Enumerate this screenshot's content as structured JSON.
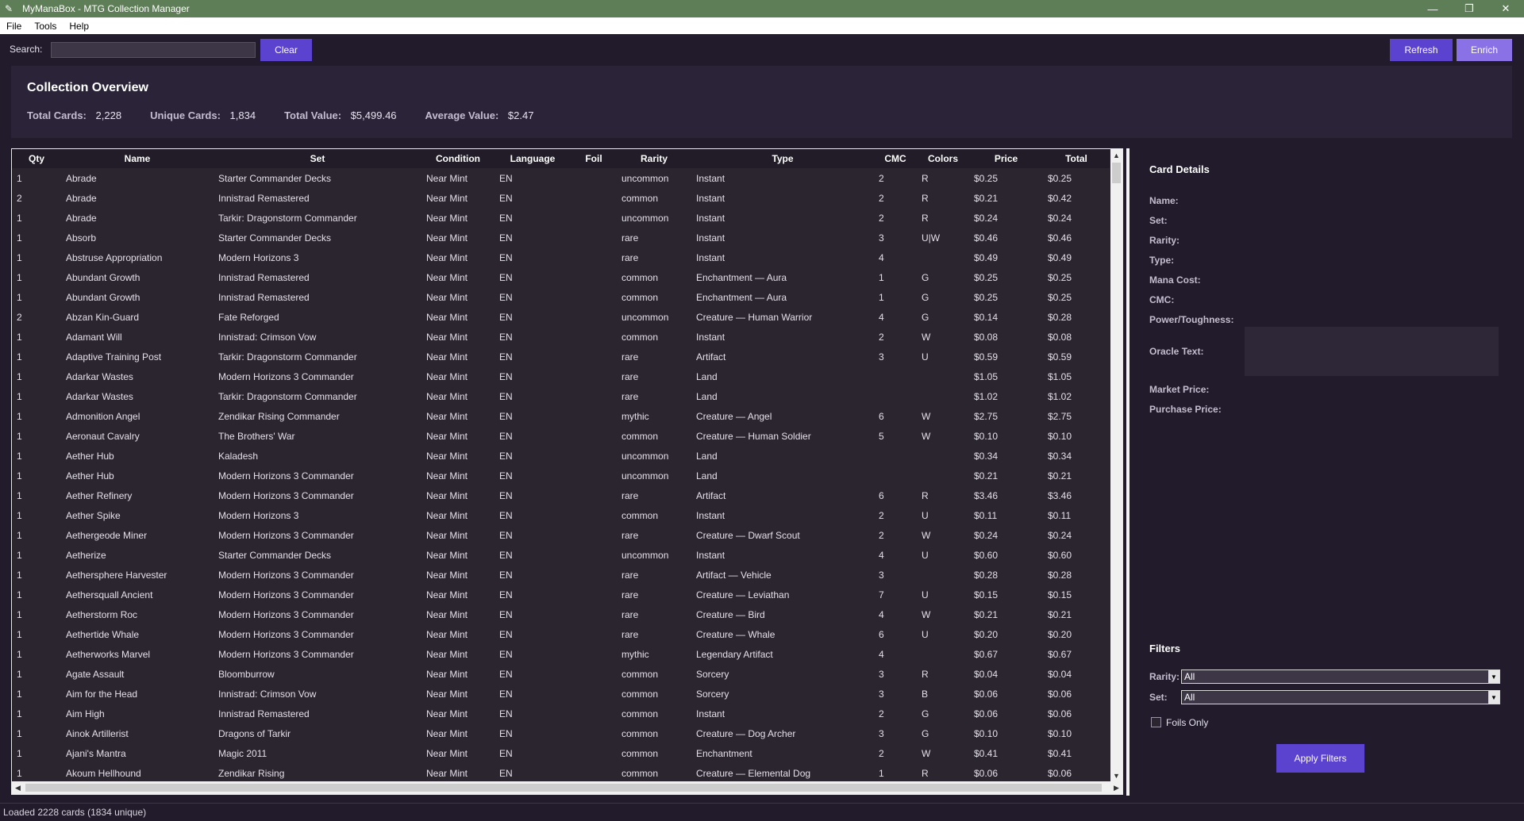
{
  "window": {
    "title": "MyManaBox - MTG Collection Manager",
    "controls": {
      "minimize": "—",
      "maximize": "❐",
      "close": "✕"
    }
  },
  "menu": [
    "File",
    "Tools",
    "Help"
  ],
  "toolbar": {
    "search_label": "Search:",
    "search_value": "",
    "clear_label": "Clear",
    "refresh_label": "Refresh",
    "enrich_label": "Enrich"
  },
  "overview": {
    "title": "Collection Overview",
    "stats": [
      {
        "label": "Total Cards:",
        "value": "2,228"
      },
      {
        "label": "Unique Cards:",
        "value": "1,834"
      },
      {
        "label": "Total Value:",
        "value": "$5,499.46"
      },
      {
        "label": "Average Value:",
        "value": "$2.47"
      }
    ]
  },
  "table": {
    "columns": [
      "Qty",
      "Name",
      "Set",
      "Condition",
      "Language",
      "Foil",
      "Rarity",
      "Type",
      "CMC",
      "Colors",
      "Price",
      "Total"
    ],
    "rows": [
      [
        "1",
        "Abrade",
        "Starter Commander Decks",
        "Near Mint",
        "EN",
        "",
        "uncommon",
        "Instant",
        "2",
        "R",
        "$0.25",
        "$0.25"
      ],
      [
        "2",
        "Abrade",
        "Innistrad Remastered",
        "Near Mint",
        "EN",
        "",
        "common",
        "Instant",
        "2",
        "R",
        "$0.21",
        "$0.42"
      ],
      [
        "1",
        "Abrade",
        "Tarkir: Dragonstorm Commander",
        "Near Mint",
        "EN",
        "",
        "uncommon",
        "Instant",
        "2",
        "R",
        "$0.24",
        "$0.24"
      ],
      [
        "1",
        "Absorb",
        "Starter Commander Decks",
        "Near Mint",
        "EN",
        "",
        "rare",
        "Instant",
        "3",
        "U|W",
        "$0.46",
        "$0.46"
      ],
      [
        "1",
        "Abstruse Appropriation",
        "Modern Horizons 3",
        "Near Mint",
        "EN",
        "",
        "rare",
        "Instant",
        "4",
        "",
        "$0.49",
        "$0.49"
      ],
      [
        "1",
        "Abundant Growth",
        "Innistrad Remastered",
        "Near Mint",
        "EN",
        "",
        "common",
        "Enchantment — Aura",
        "1",
        "G",
        "$0.25",
        "$0.25"
      ],
      [
        "1",
        "Abundant Growth",
        "Innistrad Remastered",
        "Near Mint",
        "EN",
        "",
        "common",
        "Enchantment — Aura",
        "1",
        "G",
        "$0.25",
        "$0.25"
      ],
      [
        "2",
        "Abzan Kin-Guard",
        "Fate Reforged",
        "Near Mint",
        "EN",
        "",
        "uncommon",
        "Creature — Human Warrior",
        "4",
        "G",
        "$0.14",
        "$0.28"
      ],
      [
        "1",
        "Adamant Will",
        "Innistrad: Crimson Vow",
        "Near Mint",
        "EN",
        "",
        "common",
        "Instant",
        "2",
        "W",
        "$0.08",
        "$0.08"
      ],
      [
        "1",
        "Adaptive Training Post",
        "Tarkir: Dragonstorm Commander",
        "Near Mint",
        "EN",
        "",
        "rare",
        "Artifact",
        "3",
        "U",
        "$0.59",
        "$0.59"
      ],
      [
        "1",
        "Adarkar Wastes",
        "Modern Horizons 3 Commander",
        "Near Mint",
        "EN",
        "",
        "rare",
        "Land",
        "",
        "",
        "$1.05",
        "$1.05"
      ],
      [
        "1",
        "Adarkar Wastes",
        "Tarkir: Dragonstorm Commander",
        "Near Mint",
        "EN",
        "",
        "rare",
        "Land",
        "",
        "",
        "$1.02",
        "$1.02"
      ],
      [
        "1",
        "Admonition Angel",
        "Zendikar Rising Commander",
        "Near Mint",
        "EN",
        "",
        "mythic",
        "Creature — Angel",
        "6",
        "W",
        "$2.75",
        "$2.75"
      ],
      [
        "1",
        "Aeronaut Cavalry",
        "The Brothers' War",
        "Near Mint",
        "EN",
        "",
        "common",
        "Creature — Human Soldier",
        "5",
        "W",
        "$0.10",
        "$0.10"
      ],
      [
        "1",
        "Aether Hub",
        "Kaladesh",
        "Near Mint",
        "EN",
        "",
        "uncommon",
        "Land",
        "",
        "",
        "$0.34",
        "$0.34"
      ],
      [
        "1",
        "Aether Hub",
        "Modern Horizons 3 Commander",
        "Near Mint",
        "EN",
        "",
        "uncommon",
        "Land",
        "",
        "",
        "$0.21",
        "$0.21"
      ],
      [
        "1",
        "Aether Refinery",
        "Modern Horizons 3 Commander",
        "Near Mint",
        "EN",
        "",
        "rare",
        "Artifact",
        "6",
        "R",
        "$3.46",
        "$3.46"
      ],
      [
        "1",
        "Aether Spike",
        "Modern Horizons 3",
        "Near Mint",
        "EN",
        "",
        "common",
        "Instant",
        "2",
        "U",
        "$0.11",
        "$0.11"
      ],
      [
        "1",
        "Aethergeode Miner",
        "Modern Horizons 3 Commander",
        "Near Mint",
        "EN",
        "",
        "rare",
        "Creature — Dwarf Scout",
        "2",
        "W",
        "$0.24",
        "$0.24"
      ],
      [
        "1",
        "Aetherize",
        "Starter Commander Decks",
        "Near Mint",
        "EN",
        "",
        "uncommon",
        "Instant",
        "4",
        "U",
        "$0.60",
        "$0.60"
      ],
      [
        "1",
        "Aethersphere Harvester",
        "Modern Horizons 3 Commander",
        "Near Mint",
        "EN",
        "",
        "rare",
        "Artifact — Vehicle",
        "3",
        "",
        "$0.28",
        "$0.28"
      ],
      [
        "1",
        "Aethersquall Ancient",
        "Modern Horizons 3 Commander",
        "Near Mint",
        "EN",
        "",
        "rare",
        "Creature — Leviathan",
        "7",
        "U",
        "$0.15",
        "$0.15"
      ],
      [
        "1",
        "Aetherstorm Roc",
        "Modern Horizons 3 Commander",
        "Near Mint",
        "EN",
        "",
        "rare",
        "Creature — Bird",
        "4",
        "W",
        "$0.21",
        "$0.21"
      ],
      [
        "1",
        "Aethertide Whale",
        "Modern Horizons 3 Commander",
        "Near Mint",
        "EN",
        "",
        "rare",
        "Creature — Whale",
        "6",
        "U",
        "$0.20",
        "$0.20"
      ],
      [
        "1",
        "Aetherworks Marvel",
        "Modern Horizons 3 Commander",
        "Near Mint",
        "EN",
        "",
        "mythic",
        "Legendary Artifact",
        "4",
        "",
        "$0.67",
        "$0.67"
      ],
      [
        "1",
        "Agate Assault",
        "Bloomburrow",
        "Near Mint",
        "EN",
        "",
        "common",
        "Sorcery",
        "3",
        "R",
        "$0.04",
        "$0.04"
      ],
      [
        "1",
        "Aim for the Head",
        "Innistrad: Crimson Vow",
        "Near Mint",
        "EN",
        "",
        "common",
        "Sorcery",
        "3",
        "B",
        "$0.06",
        "$0.06"
      ],
      [
        "1",
        "Aim High",
        "Innistrad Remastered",
        "Near Mint",
        "EN",
        "",
        "common",
        "Instant",
        "2",
        "G",
        "$0.06",
        "$0.06"
      ],
      [
        "1",
        "Ainok Artillerist",
        "Dragons of Tarkir",
        "Near Mint",
        "EN",
        "",
        "common",
        "Creature — Dog Archer",
        "3",
        "G",
        "$0.10",
        "$0.10"
      ],
      [
        "1",
        "Ajani's Mantra",
        "Magic 2011",
        "Near Mint",
        "EN",
        "",
        "common",
        "Enchantment",
        "2",
        "W",
        "$0.41",
        "$0.41"
      ],
      [
        "1",
        "Akoum Hellhound",
        "Zendikar Rising",
        "Near Mint",
        "EN",
        "",
        "common",
        "Creature — Elemental Dog",
        "1",
        "R",
        "$0.06",
        "$0.06"
      ]
    ]
  },
  "details": {
    "title": "Card Details",
    "labels": {
      "name": "Name:",
      "set": "Set:",
      "rarity": "Rarity:",
      "type": "Type:",
      "mana_cost": "Mana Cost:",
      "cmc": "CMC:",
      "power_toughness": "Power/Toughness:",
      "oracle_text": "Oracle Text:",
      "market_price": "Market Price:",
      "purchase_price": "Purchase Price:"
    }
  },
  "filters": {
    "title": "Filters",
    "rarity_label": "Rarity:",
    "rarity_value": "All",
    "set_label": "Set:",
    "set_value": "All",
    "foils_label": "Foils Only",
    "apply_label": "Apply Filters"
  },
  "status": "Loaded 2228 cards (1834 unique)",
  "colors": {
    "accent": "#5b42cf",
    "accent_light": "#8a72e6",
    "titlebar": "#5e7e57",
    "background": "#211b2b",
    "panel": "#2b2439"
  }
}
